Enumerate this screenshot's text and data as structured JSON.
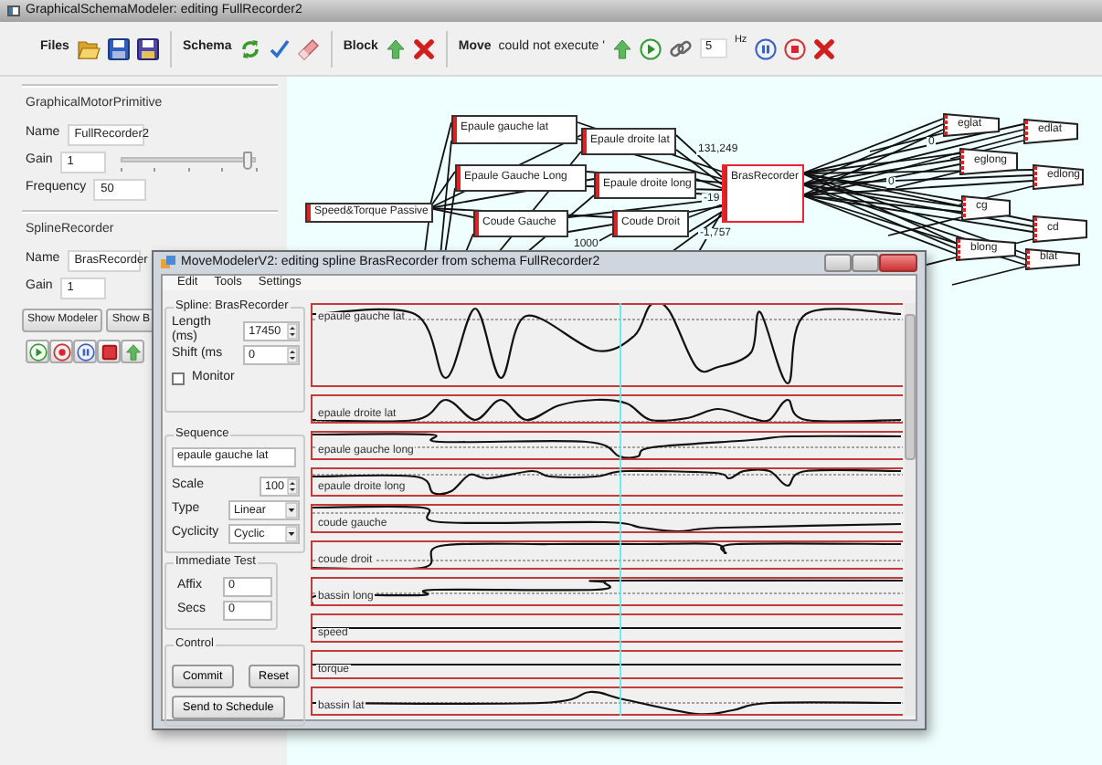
{
  "window": {
    "title": "GraphicalSchemaModeler: editing FullRecorder2"
  },
  "toolbar": {
    "groups": [
      {
        "label": "Files"
      },
      {
        "label": "Schema"
      },
      {
        "label": "Block"
      },
      {
        "label": "Move",
        "status": "could not execute '"
      }
    ],
    "rate": {
      "value": "5",
      "unit": "Hz"
    }
  },
  "motor_primitive": {
    "title": "GraphicalMotorPrimitive",
    "fields": [
      {
        "label": "Name",
        "value": "FullRecorder2"
      },
      {
        "label": "Gain",
        "value": "1"
      },
      {
        "label": "Frequency",
        "value": "50"
      }
    ],
    "gain_slider": {
      "level": 0.95
    }
  },
  "spline_recorder": {
    "title": "SplineRecorder",
    "fields": [
      {
        "label": "Name",
        "value": "BrasRecorder"
      },
      {
        "label": "Gain",
        "value": "1"
      }
    ],
    "buttons": [
      "Show Modeler",
      "Show B"
    ]
  },
  "schema_canvas": {
    "blocks": [
      {
        "label": "Epaule gauche lat",
        "kind": "block"
      },
      {
        "label": "Epaule droite lat",
        "kind": "block"
      },
      {
        "label": "Epaule Gauche Long",
        "kind": "block"
      },
      {
        "label": "Epaule droite long",
        "kind": "block"
      },
      {
        "label": "Speed&Torque Passive",
        "kind": "block"
      },
      {
        "label": "Coude Gauche",
        "kind": "block"
      },
      {
        "label": "Coude Droit",
        "kind": "block"
      },
      {
        "label": "BrasRecorder",
        "kind": "recorder"
      },
      {
        "label": "eglat",
        "kind": "output"
      },
      {
        "label": "edlat",
        "kind": "output"
      },
      {
        "label": "eglong",
        "kind": "output"
      },
      {
        "label": "edlong",
        "kind": "output"
      },
      {
        "label": "cg",
        "kind": "output"
      },
      {
        "label": "cd",
        "kind": "output"
      },
      {
        "label": "blong",
        "kind": "output"
      },
      {
        "label": "blat",
        "kind": "output"
      }
    ],
    "edge_labels": [
      "131,249",
      "-19",
      "1000",
      "-1,757",
      "0",
      "0"
    ]
  },
  "modeler": {
    "title": "MoveModelerV2: editing spline BrasRecorder from schema FullRecorder2",
    "menu": [
      "Edit",
      "Tools",
      "Settings"
    ],
    "spline": {
      "title": "Spline: BrasRecorder",
      "length_label": "Length (ms)",
      "length": "17450",
      "shift_label": "Shift (ms",
      "shift": "0",
      "monitor": {
        "label": "Monitor",
        "checked": false
      }
    },
    "sequence": {
      "title": "Sequence",
      "name": "epaule gauche lat",
      "scale_label": "Scale",
      "scale": "100",
      "type_label": "Type",
      "type": "Linear",
      "cyclicity_label": "Cyclicity",
      "cyclicity": "Cyclic"
    },
    "immediate_test": {
      "title": "Immediate Test",
      "fields": [
        {
          "label": "Affix",
          "value": "0"
        },
        {
          "label": "Secs",
          "value": "0"
        }
      ]
    },
    "control": {
      "title": "Control",
      "buttons": [
        "Commit",
        "Reset",
        "Send to Schedule"
      ]
    },
    "tracks": [
      {
        "label": "epaule gauche lat"
      },
      {
        "label": "epaule droite lat"
      },
      {
        "label": "epaule gauche long"
      },
      {
        "label": "epaule droite long"
      },
      {
        "label": "coude gauche"
      },
      {
        "label": "coude droit"
      },
      {
        "label": "bassin long"
      },
      {
        "label": "speed"
      },
      {
        "label": "torque"
      },
      {
        "label": "bassin lat"
      }
    ]
  }
}
